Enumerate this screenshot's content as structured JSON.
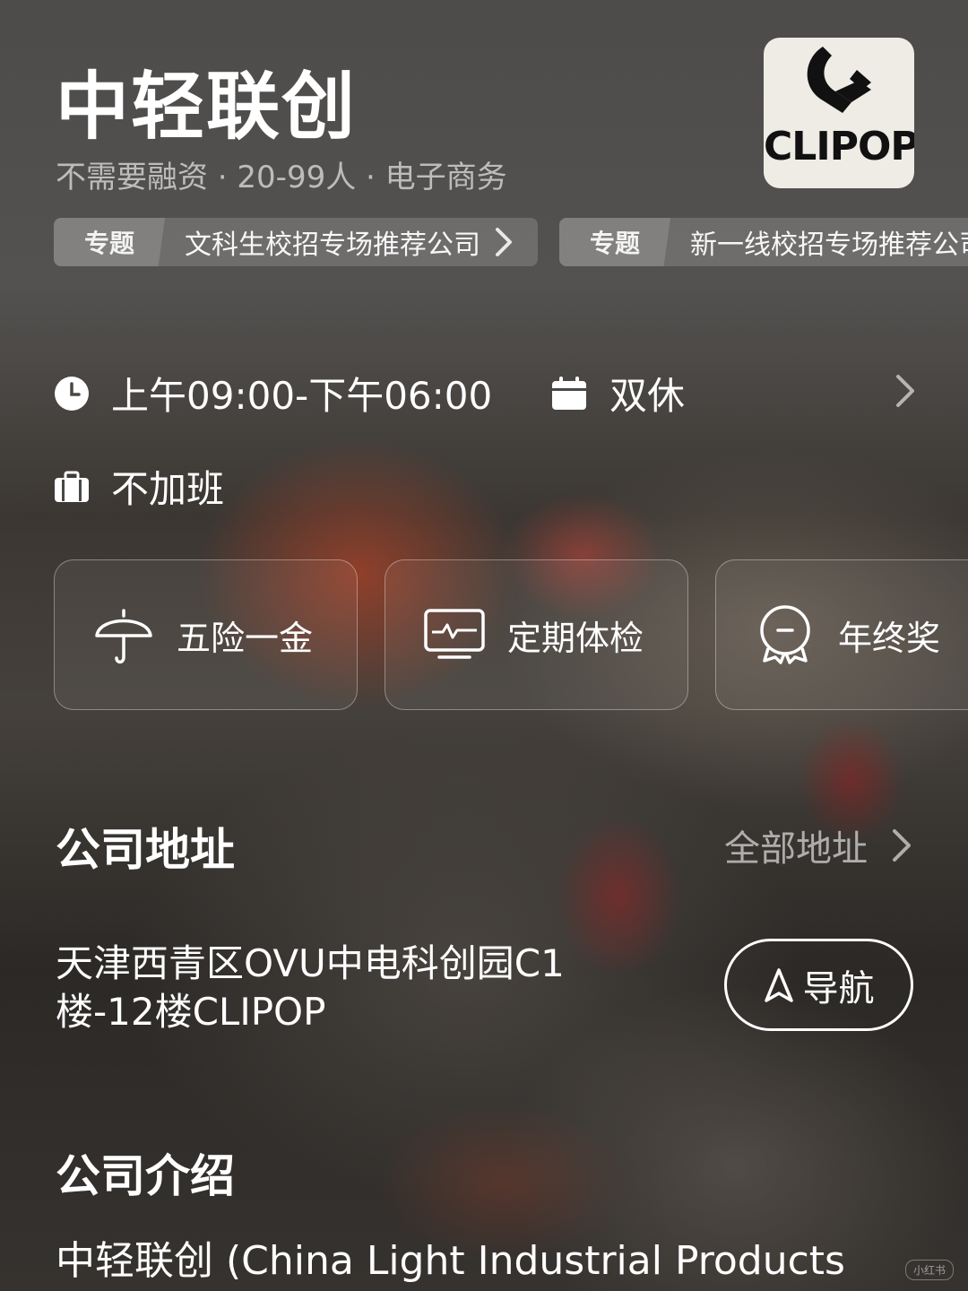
{
  "company": {
    "name": "中轻联创",
    "meta": "不需要融资 · 20-99人 · 电子商务",
    "logo_text": "CLIPOP"
  },
  "topics": [
    {
      "tag": "专题",
      "text": "文科生校招专场推荐公司"
    },
    {
      "tag": "专题",
      "text": "新一线校招专场推荐公司"
    }
  ],
  "work": {
    "hours": "上午09:00-下午06:00",
    "rest": "双休",
    "overtime": "不加班"
  },
  "benefits": [
    {
      "icon": "umbrella-icon",
      "label": "五险一金"
    },
    {
      "icon": "health-monitor-icon",
      "label": "定期体检"
    },
    {
      "icon": "award-medal-icon",
      "label": "年终奖"
    }
  ],
  "address_section": {
    "title": "公司地址",
    "all_link": "全部地址",
    "address": "天津西青区OVU中电科创园C1楼-12楼CLIPOP",
    "nav_label": "导航"
  },
  "intro_section": {
    "title": "公司介绍",
    "text": "中轻联创 (China Light Industrial Products"
  },
  "watermark": "小红书"
}
